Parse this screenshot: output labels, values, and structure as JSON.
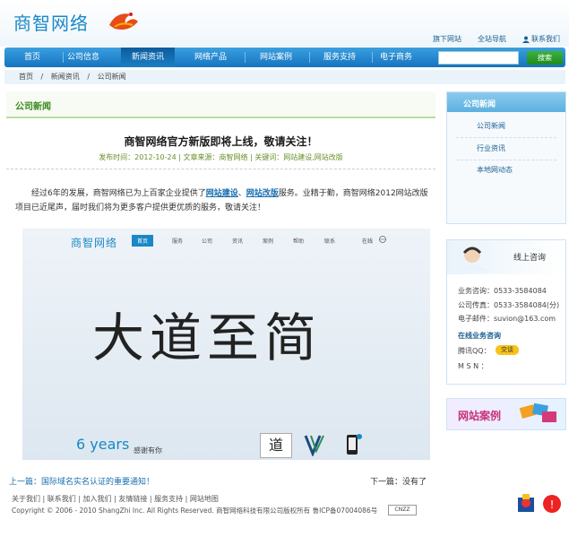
{
  "header": {
    "logo_text": "商智网络",
    "top_links": [
      "旗下网站",
      "全站导航",
      "联系我们"
    ]
  },
  "nav": {
    "items": [
      "首页",
      "公司信息",
      "新闻资讯",
      "网络产品",
      "网站案例",
      "服务支持",
      "电子商务"
    ],
    "active_index": 2,
    "search_placeholder": "",
    "search_button": "搜索"
  },
  "breadcrumb": [
    "首页",
    "新闻资讯",
    "公司新闻"
  ],
  "breadcrumb_sep": "/",
  "main": {
    "section_title": "公司新闻",
    "article_title": "商智网络官方新版即将上线，敬请关注！",
    "meta": "发布时间：2012-10-24  |  文章来源：商智网络  |  关键词：网站建设,网站改版",
    "body_part1": "经过6年的发展，商智网络已为上百家企业提供了",
    "link1": "网站建设",
    "sep1": "、",
    "link2": "网站改版",
    "body_part2": "服务。业精于勤，商智网络2012网站改版项目已近尾声，届时我们将为更多客户提供更优质的服务，敬请关注！",
    "prev": "上一篇：国际域名实名认证的重要通知！",
    "next": "下一篇：没有了"
  },
  "hero": {
    "logo": "商智网络",
    "nav": [
      "首页",
      "服务",
      "公司",
      "资讯",
      "案例",
      "帮助",
      "联系"
    ],
    "tag": "在线",
    "big_text": "大道至简",
    "years": "6 years",
    "thanks": "感谢有你",
    "icon_text": "道"
  },
  "sidebar": {
    "title": "公司新闻",
    "links": [
      "公司新闻",
      "行业资讯",
      "本地网动态"
    ],
    "contact_online": "线上咨询",
    "contact_lines": [
      "业务咨询：0533-3584084",
      "公司传真：0533-3584084(分)",
      "电子邮件：suvion@163.com",
      "在线业务咨询",
      "腾讯QQ：",
      "M S N ："
    ],
    "qq_badge": "交谈",
    "case_title": "网站案例"
  },
  "footer": {
    "links": "关于我们 | 联系我们 | 加入我们 | 友情链接 | 服务支持 | 网站地图",
    "copyright": "Copyright © 2006 - 2010 ShangZhi Inc. All Rights Reserved. 商智网络科技有限公司版权所有    鲁ICP备07004086号",
    "cnzz": "CNZZ"
  }
}
